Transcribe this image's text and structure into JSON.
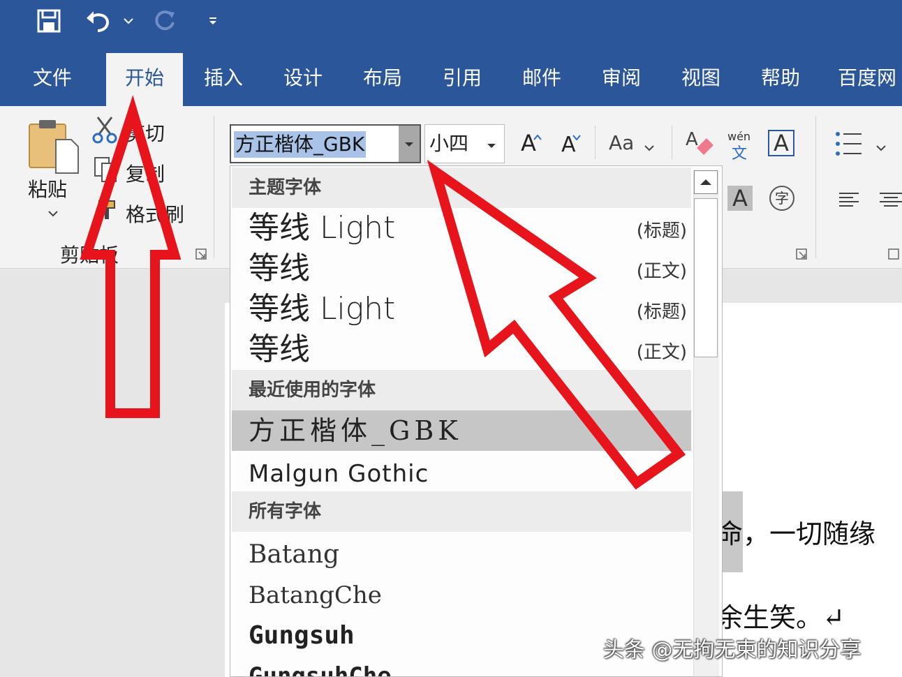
{
  "quick_access": {
    "save_icon": "save-icon",
    "undo_icon": "undo-icon",
    "redo_icon": "redo-icon",
    "customize_icon": "customize-qat-icon"
  },
  "tabs": [
    {
      "label": "文件"
    },
    {
      "label": "开始",
      "active": true
    },
    {
      "label": "插入"
    },
    {
      "label": "设计"
    },
    {
      "label": "布局"
    },
    {
      "label": "引用"
    },
    {
      "label": "邮件"
    },
    {
      "label": "审阅"
    },
    {
      "label": "视图"
    },
    {
      "label": "帮助"
    },
    {
      "label": "百度网"
    }
  ],
  "clipboard": {
    "paste_label": "粘贴",
    "cut_label": "剪切",
    "copy_label": "复制",
    "format_painter_label": "格式刷",
    "group_label": "剪贴板"
  },
  "font": {
    "font_name": "方正楷体_GBK",
    "font_size": "小四",
    "grow_label": "A",
    "shrink_label": "A",
    "change_case_label": "Aa",
    "pinyin_top": "wén",
    "pinyin_bottom": "文",
    "border_char": "A",
    "shade_char": "A",
    "enclose_char": "字"
  },
  "dropdown": {
    "sections": [
      {
        "header": "主题字体",
        "items": [
          {
            "name": "等线 Light",
            "tag": "(标题)"
          },
          {
            "name": "等线",
            "tag": "(正文)"
          },
          {
            "name": "等线 Light",
            "tag": "(标题)"
          },
          {
            "name": "等线",
            "tag": "(正文)"
          }
        ]
      },
      {
        "header": "最近使用的字体",
        "items": [
          {
            "name": "方正楷体_GBK",
            "selected": true
          },
          {
            "name": "Malgun Gothic"
          }
        ]
      },
      {
        "header": "所有字体",
        "items": [
          {
            "name": "Batang"
          },
          {
            "name": "BatangChe"
          },
          {
            "name": "Gungsuh"
          },
          {
            "name": "GungsuhChe"
          }
        ]
      }
    ]
  },
  "document": {
    "line1": "命，一切随缘",
    "line2": "余生笑。↵"
  },
  "watermark": "头条 @无拘无束的知识分享",
  "colors": {
    "accent": "#2b579a",
    "highlight": "#a9c3e8",
    "arrow": "#e8141b"
  }
}
